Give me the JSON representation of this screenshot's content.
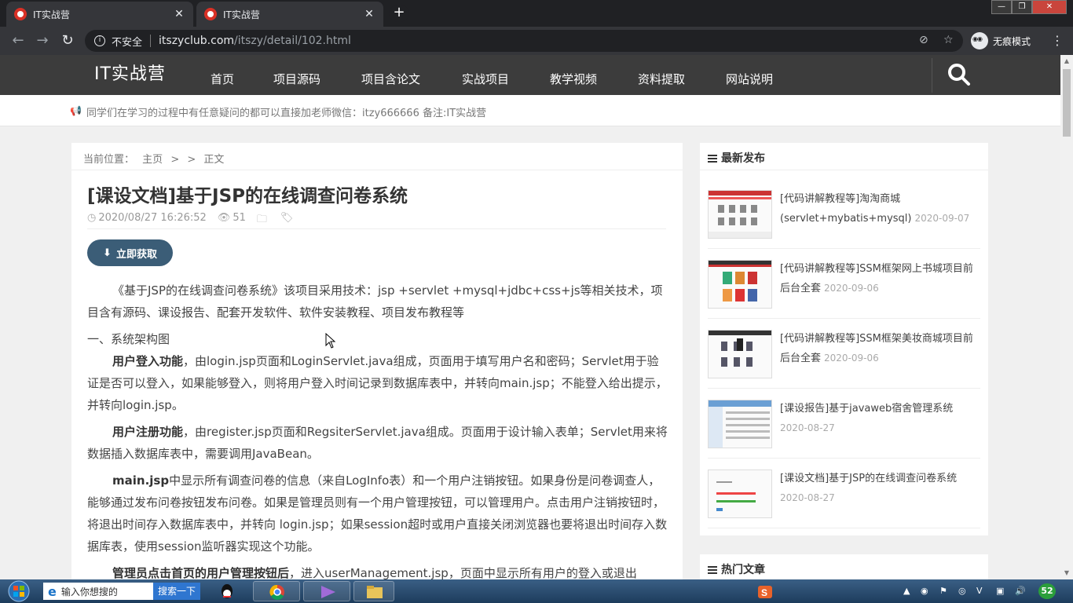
{
  "browser": {
    "tabs": [
      {
        "title": "IT实战营"
      },
      {
        "title": "IT实战营"
      }
    ],
    "new_tab": "+",
    "security_label": "不安全",
    "url_host": "itszyclub.com",
    "url_path": "/itszy/detail/102.html",
    "incognito_label": "无痕模式"
  },
  "site": {
    "logo": "IT实战营",
    "nav": [
      "首页",
      "项目源码",
      "项目含论文",
      "实战项目",
      "教学视频",
      "资料提取",
      "网站说明"
    ],
    "notice": "同学们在学习的过程中有任意疑问的都可以直接加老师微信：itzy666666 备注:IT实战营"
  },
  "article": {
    "breadcrumb": {
      "label": "当前位置：",
      "home": "主页",
      "sep1": ">",
      "sep2": ">",
      "current": "正文"
    },
    "title": "[课设文档]基于JSP的在线调查问卷系统",
    "date": "2020/08/27 16:26:52",
    "views": "51",
    "get_button": "立即获取",
    "intro": "《基于JSP的在线调查问卷系统》该项目采用技术：jsp +servlet +mysql+jdbc+css+js等相关技术，项目含有源码、课设报告、配套开发软件、软件安装教程、项目发布教程等",
    "section1": "一、系统架构图",
    "p1_bold": "用户登入功能",
    "p1_text": "，由login.jsp页面和LoginServlet.java组成，页面用于填写用户名和密码；Servlet用于验证是否可以登入，如果能够登入，则将用户登入时间记录到数据库表中，并转向main.jsp；不能登入给出提示，并转向login.jsp。",
    "p2_bold": "用户注册功能",
    "p2_text": "，由register.jsp页面和RegsiterServlet.java组成。页面用于设计输入表单；Servlet用来将数据插入数据库表中，需要调用JavaBean。",
    "p3_bold": "main.jsp",
    "p3_text": "中显示所有调查问卷的信息（来自LogInfo表）和一个用户注销按钮。如果身份是问卷调查人，能够通过发布问卷按钮发布问卷。如果是管理员则有一个用户管理按钮，可以管理用户。点击用户注销按钮时，将退出时间存入数据库表中，并转向 login.jsp；如果session超时或用户直接关闭浏览器也要将退出时间存入数据库表，使用session监听器实现这个功能。",
    "p4_bold": "管理员点击首页的用户管理按钮后",
    "p4_text": "，进入userManagement.jsp，页面中显示所有用户的登入或退出"
  },
  "sidebar": {
    "latest_title": "最新发布",
    "posts": [
      {
        "title": "[代码讲解教程等]淘淘商城(servlet+mybatis+mysql)",
        "date": "2020-09-07"
      },
      {
        "title": "[代码讲解教程等]SSM框架网上书城项目前后台全套",
        "date": "2020-09-06"
      },
      {
        "title": "[代码讲解教程等]SSM框架美妆商城项目前后台全套",
        "date": "2020-09-06"
      },
      {
        "title": "[课设报告]基于javaweb宿舍管理系统",
        "date": "2020-08-27"
      },
      {
        "title": "[课设文档]基于JSP的在线调查问卷系统",
        "date": "2020-08-27"
      }
    ],
    "hot_title": "热门文章"
  },
  "taskbar": {
    "search_placeholder": "输入你想搜的",
    "search_button": "搜索一下",
    "clock_badge": "52"
  },
  "colors": {
    "nav_bg": "#3c3c3c",
    "button_bg": "#3b5d77",
    "browser_bg": "#35363a"
  }
}
